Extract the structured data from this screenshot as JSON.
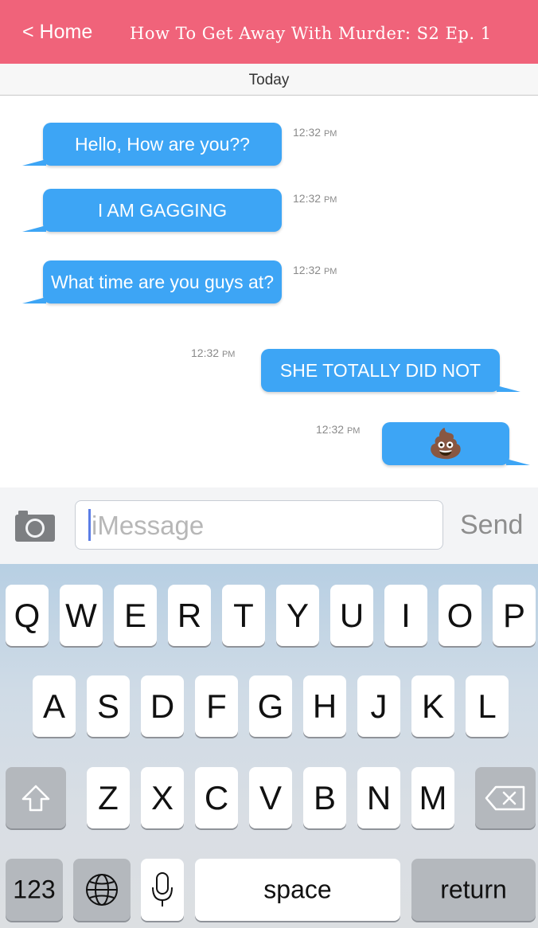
{
  "header": {
    "back_label": "< Home",
    "title": "How To Get Away With Murder: S2 Ep. 1"
  },
  "date_divider": "Today",
  "messages": [
    {
      "direction": "incoming",
      "text": "Hello, How are you??",
      "time": "12:32",
      "ampm": "PM"
    },
    {
      "direction": "incoming",
      "text": "I AM GAGGING",
      "time": "12:32",
      "ampm": "PM"
    },
    {
      "direction": "incoming",
      "text": "What time are you guys at?",
      "time": "12:32",
      "ampm": "PM"
    },
    {
      "direction": "outgoing",
      "text": "SHE TOTALLY DID NOT",
      "time": "12:32",
      "ampm": "PM"
    },
    {
      "direction": "outgoing",
      "text": "💩",
      "time": "12:32",
      "ampm": "PM"
    }
  ],
  "composer": {
    "placeholder": "iMessage",
    "send_label": "Send",
    "camera_icon": "camera-icon"
  },
  "keyboard": {
    "row1": [
      "Q",
      "W",
      "E",
      "R",
      "T",
      "Y",
      "U",
      "I",
      "O",
      "P"
    ],
    "row2": [
      "A",
      "S",
      "D",
      "F",
      "G",
      "H",
      "J",
      "K",
      "L"
    ],
    "row3": [
      "Z",
      "X",
      "C",
      "V",
      "B",
      "N",
      "M"
    ],
    "numbers_label": "123",
    "space_label": "space",
    "return_label": "return",
    "shift_icon": "shift-icon",
    "delete_icon": "delete-icon",
    "globe_icon": "globe-icon",
    "mic_icon": "microphone-icon"
  },
  "colors": {
    "header": "#f0637a",
    "bubble": "#3da5f5"
  }
}
